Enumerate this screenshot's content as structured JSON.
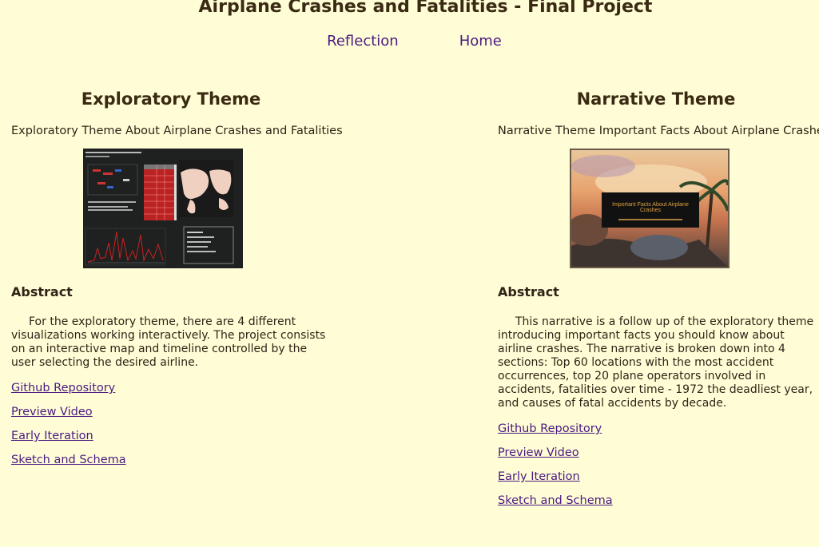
{
  "header": {
    "title": "Airplane Crashes and Fatalities - Final Project",
    "nav": [
      {
        "label": "Reflection"
      },
      {
        "label": "Home"
      }
    ]
  },
  "exploratory": {
    "title": "Exploratory Theme",
    "subtitle": "Exploratory Theme About Airplane Crashes and Fatalities",
    "thumbnail_icon": "dashboard-screenshot",
    "abstract_title": "Abstract",
    "abstract": "For the exploratory theme, there are 4 different visualizations working interactively. The project consists on an interactive map and timeline controlled by the user selecting the desired airline.",
    "links": [
      {
        "label": "Github Repository"
      },
      {
        "label": "Preview Video"
      },
      {
        "label": "Early Iteration"
      },
      {
        "label": "Sketch and Schema"
      }
    ]
  },
  "narrative": {
    "title": "Narrative Theme",
    "subtitle": "Narrative Theme Important Facts About Airplane Crashes",
    "thumbnail_icon": "narrative-title-slide",
    "thumbnail_caption": "Important Facts About Airplane Crashes",
    "abstract_title": "Abstract",
    "abstract": "This narrative is a follow up of the exploratory theme introducing important facts you should know about airline crashes. The narrative is broken down into 4 sections: Top 60 locations with the most accident occurrences, top 20 plane operators involved in accidents, fatalities over time - 1972 the deadliest year, and causes of fatal accidents by decade.",
    "links": [
      {
        "label": "Github Repository"
      },
      {
        "label": "Preview Video"
      },
      {
        "label": "Early Iteration"
      },
      {
        "label": "Sketch and Schema"
      }
    ]
  },
  "colors": {
    "background": "#fffdd5",
    "link": "#4a1a82",
    "heading": "#3a2a14"
  }
}
